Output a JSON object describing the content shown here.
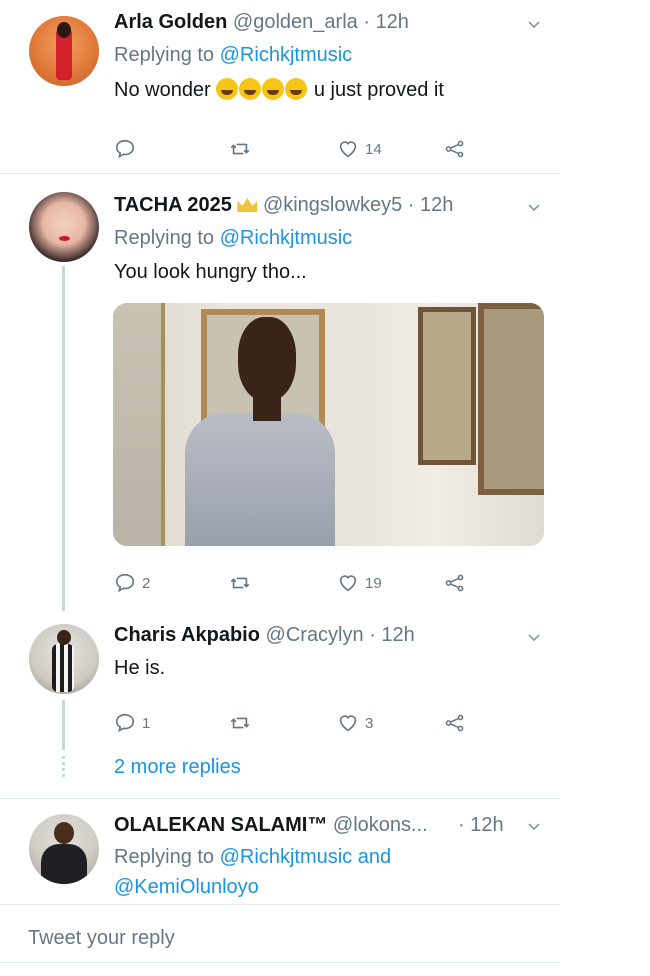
{
  "tweets": [
    {
      "name": "Arla Golden",
      "handle": "@golden_arla",
      "time": "· 12h",
      "replying_label": "Replying to",
      "replying_to": "@Richkjtmusic",
      "text_after_emoji": "u just proved it",
      "text_before_emoji": "No wonder",
      "emoji_count": 4,
      "likes": "14"
    },
    {
      "name": "TACHA 2025",
      "handle": "@kingslowkey5",
      "time": "· 12h",
      "replying_label": "Replying to",
      "replying_to": "@Richkjtmusic",
      "text": "You look hungry tho...",
      "replies": "2",
      "likes": "19"
    },
    {
      "name": "Charis Akpabio",
      "handle": "@Cracylyn",
      "time": "· 12h",
      "text": "He is.",
      "replies": "1",
      "likes": "3"
    },
    {
      "name": "OLALEKAN SALAMI™",
      "handle": "@lokons...",
      "time": "· 12h",
      "replying_label": "Replying to",
      "replying_to": "@Richkjtmusic and",
      "replying_to_2": "@KemiOlunloyo"
    }
  ],
  "more_replies": "2 more replies",
  "compose_placeholder": "Tweet your reply",
  "colors": {
    "link": "#1b95e0",
    "muted": "#657786",
    "divider": "#e6ecf0"
  },
  "icons": [
    "reply-icon",
    "retweet-icon",
    "like-icon",
    "share-icon",
    "chevron-down-icon",
    "crown-emoji-icon",
    "laughing-emoji-icon"
  ]
}
